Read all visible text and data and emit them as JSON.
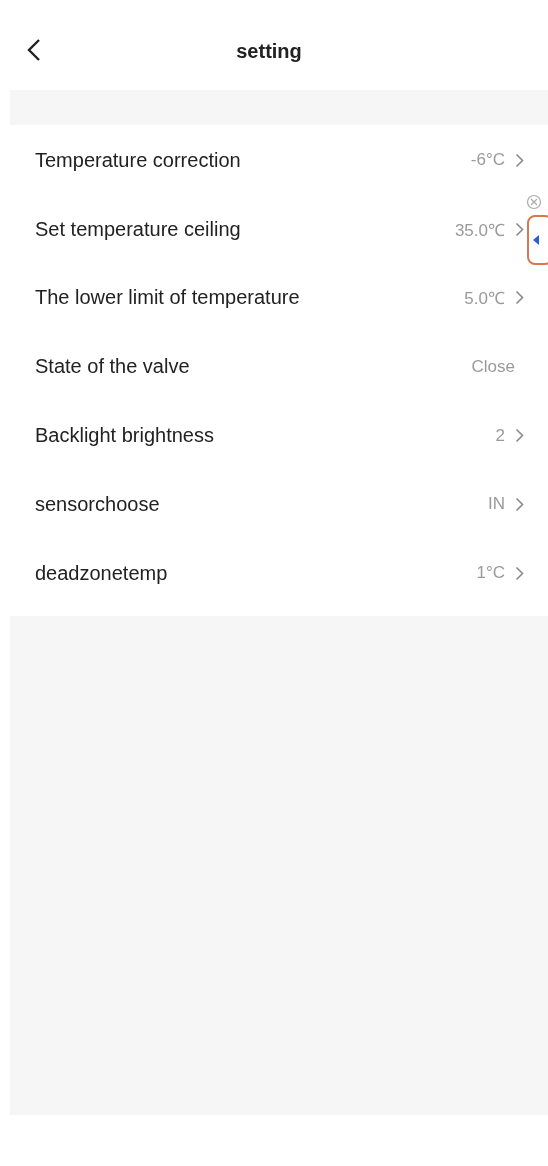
{
  "header": {
    "title": "setting"
  },
  "settings": [
    {
      "label": "Temperature correction",
      "value": "-6°C",
      "has_arrow": true
    },
    {
      "label": "Set temperature ceiling",
      "value": "35.0℃",
      "has_arrow": true
    },
    {
      "label": "The lower limit of temperature",
      "value": "5.0℃",
      "has_arrow": true
    },
    {
      "label": "State of the valve",
      "value": "Close",
      "has_arrow": false
    },
    {
      "label": "Backlight brightness",
      "value": "2",
      "has_arrow": true
    },
    {
      "label": "sensorchoose",
      "value": "IN",
      "has_arrow": true
    },
    {
      "label": "deadzonetemp",
      "value": "1°C",
      "has_arrow": true
    }
  ]
}
